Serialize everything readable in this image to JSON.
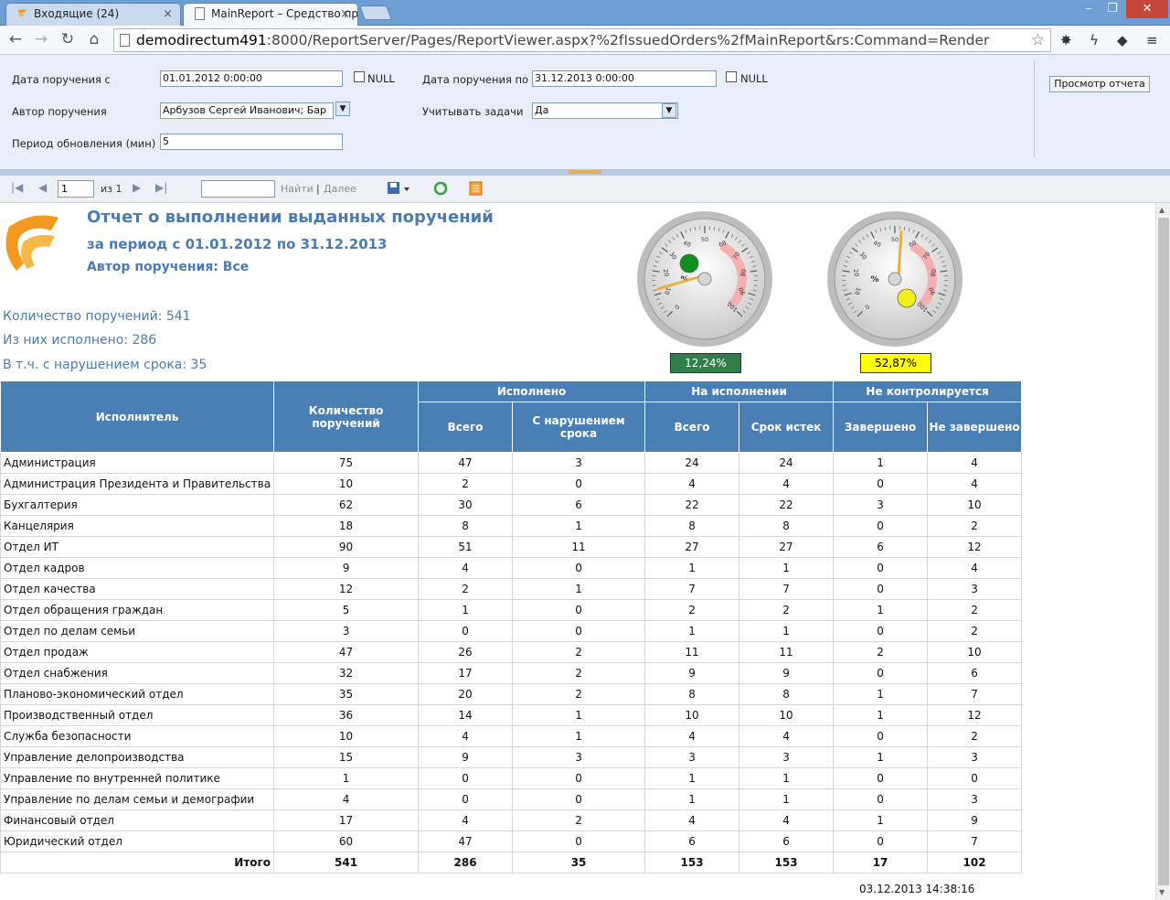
{
  "browser": {
    "tabs": [
      {
        "label": "Входящие (24)",
        "close": "×"
      },
      {
        "label": "MainReport – Средство пр",
        "close": "×"
      }
    ],
    "window_controls": [
      "–",
      "❐",
      "✕"
    ],
    "url_host": "demodirectum491",
    "url_rest": ":8000/ReportServer/Pages/ReportViewer.aspx?%2fIssuedOrders%2fMainReport&rs:Command=Render"
  },
  "params": {
    "date_from_label": "Дата поручения с",
    "date_from_value": "01.01.2012 0:00:00",
    "date_to_label": "Дата поручения по",
    "date_to_value": "31.12.2013 0:00:00",
    "null_label": "NULL",
    "author_label": "Автор поручения",
    "author_value": "Арбузов Сергей Иванович; Бар",
    "tasks_label": "Учитывать задачи",
    "tasks_value": "Да",
    "period_label": "Период обновления (мин)",
    "period_value": "5",
    "view_button": "Просмотр отчета"
  },
  "toolbar": {
    "page_value": "1",
    "of_label": "из 1",
    "find_label": "Найти",
    "separator": "|",
    "next_label": "Далее"
  },
  "report": {
    "title": "Отчет о выполнении выданных поручений",
    "period": "за период с 01.01.2012 по 31.12.2013",
    "author": "Автор поручения: Все",
    "stat_total": "Количество поручений: 541",
    "stat_done": "Из них исполнено: 286",
    "stat_violated": "В т.ч. с нарушением срока: 35",
    "gauge1": {
      "value": 12.24,
      "label": "12,24%",
      "unit": "%",
      "indicator_color": "#0f8f1c",
      "box_color": "#2f7f4a"
    },
    "gauge2": {
      "value": 52.87,
      "label": "52,87%",
      "unit": "%",
      "indicator_color": "#f2ef1a",
      "box_color": "#ffff00"
    },
    "gauge_ticks": [
      "0",
      "10",
      "20",
      "30",
      "40",
      "50",
      "60",
      "70",
      "80",
      "90",
      "100"
    ],
    "timestamp": "03.12.2013 14:38:16"
  },
  "table": {
    "h_executor": "Исполнитель",
    "h_count": "Количество поручений",
    "h_done": "Исполнено",
    "h_in_progress": "На исполнении",
    "h_uncontrolled": "Не контролируется",
    "h_done_total": "Всего",
    "h_done_violated": "С нарушением срока",
    "h_prog_total": "Всего",
    "h_prog_expired": "Срок истек",
    "h_unc_finished": "Завершено",
    "h_unc_unfinished": "Не завершено",
    "rows": [
      [
        "Администрация",
        "75",
        "47",
        "3",
        "24",
        "24",
        "1",
        "4"
      ],
      [
        "Администрация Президента и Правительства",
        "10",
        "2",
        "0",
        "4",
        "4",
        "0",
        "4"
      ],
      [
        "Бухгалтерия",
        "62",
        "30",
        "6",
        "22",
        "22",
        "3",
        "10"
      ],
      [
        "Канцелярия",
        "18",
        "8",
        "1",
        "8",
        "8",
        "0",
        "2"
      ],
      [
        "Отдел ИТ",
        "90",
        "51",
        "11",
        "27",
        "27",
        "6",
        "12"
      ],
      [
        "Отдел кадров",
        "9",
        "4",
        "0",
        "1",
        "1",
        "0",
        "4"
      ],
      [
        "Отдел качества",
        "12",
        "2",
        "1",
        "7",
        "7",
        "0",
        "3"
      ],
      [
        "Отдел обращения граждан",
        "5",
        "1",
        "0",
        "2",
        "2",
        "1",
        "2"
      ],
      [
        "Отдел по делам семьи",
        "3",
        "0",
        "0",
        "1",
        "1",
        "0",
        "2"
      ],
      [
        "Отдел продаж",
        "47",
        "26",
        "2",
        "11",
        "11",
        "2",
        "10"
      ],
      [
        "Отдел снабжения",
        "32",
        "17",
        "2",
        "9",
        "9",
        "0",
        "6"
      ],
      [
        "Планово-экономический отдел",
        "35",
        "20",
        "2",
        "8",
        "8",
        "1",
        "7"
      ],
      [
        "Производственный отдел",
        "36",
        "14",
        "1",
        "10",
        "10",
        "1",
        "12"
      ],
      [
        "Служба безопасности",
        "10",
        "4",
        "1",
        "4",
        "4",
        "0",
        "2"
      ],
      [
        "Управление делопроизводства",
        "15",
        "9",
        "3",
        "3",
        "3",
        "1",
        "3"
      ],
      [
        "Управление по внутренней политике",
        "1",
        "0",
        "0",
        "1",
        "1",
        "0",
        "0"
      ],
      [
        "Управление по делам семьи и демографии",
        "4",
        "0",
        "0",
        "1",
        "1",
        "0",
        "3"
      ],
      [
        "Финансовый отдел",
        "17",
        "4",
        "2",
        "4",
        "4",
        "1",
        "9"
      ],
      [
        "Юридический отдел",
        "60",
        "47",
        "0",
        "6",
        "6",
        "0",
        "7"
      ]
    ],
    "total": [
      "Итого",
      "541",
      "286",
      "35",
      "153",
      "153",
      "17",
      "102"
    ]
  }
}
